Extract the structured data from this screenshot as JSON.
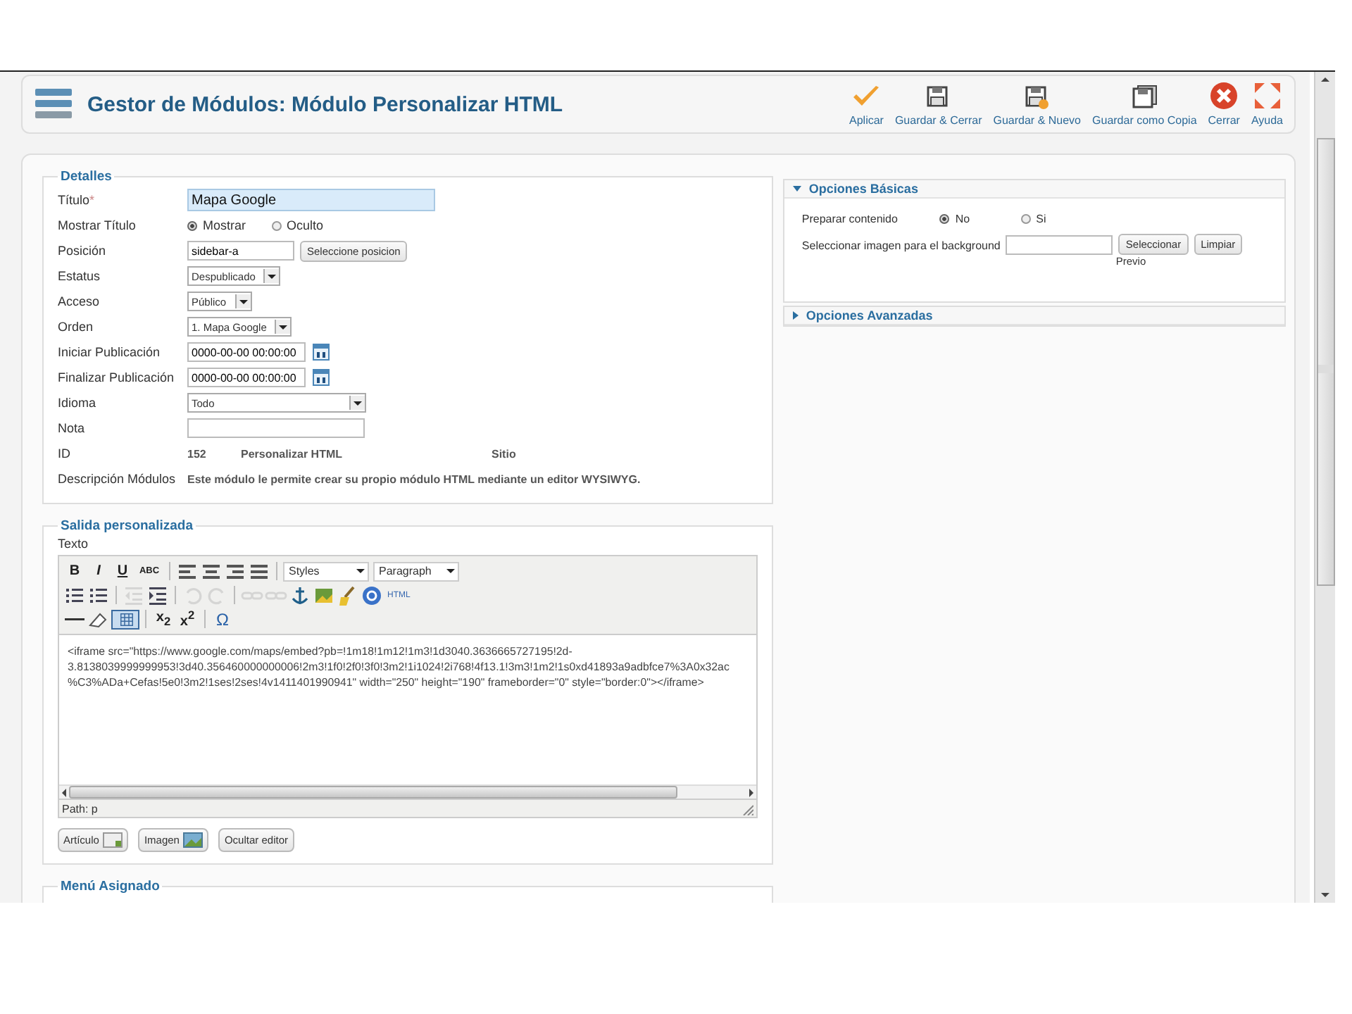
{
  "header": {
    "title": "Gestor de Módulos: Módulo Personalizar HTML",
    "actions": [
      {
        "kind": "apply",
        "label": "Aplicar"
      },
      {
        "kind": "save-close",
        "label": "Guardar & Cerrar"
      },
      {
        "kind": "save-new",
        "label": "Guardar & Nuevo"
      },
      {
        "kind": "save-copy",
        "label": "Guardar como Copia"
      },
      {
        "kind": "close",
        "label": "Cerrar"
      },
      {
        "kind": "help",
        "label": "Ayuda"
      }
    ]
  },
  "details": {
    "legend": "Detalles",
    "rows": [
      {
        "kind": "title",
        "label": "Título",
        "required": "*",
        "value": "Mapa Google"
      },
      {
        "kind": "radio",
        "label": "Mostrar Título",
        "options": [
          {
            "label": "Mostrar",
            "selected": true
          },
          {
            "label": "Oculto",
            "selected": false
          }
        ]
      },
      {
        "kind": "position",
        "label": "Posición",
        "value": "sidebar-a",
        "button": "Seleccione posicion"
      },
      {
        "kind": "select",
        "label": "Estatus",
        "value": "Despublicado"
      },
      {
        "kind": "select",
        "label": "Acceso",
        "value": "Público"
      },
      {
        "kind": "select",
        "label": "Orden",
        "value": "1. Mapa Google"
      },
      {
        "kind": "date",
        "label": "Iniciar Publicación",
        "value": "0000-00-00 00:00:00"
      },
      {
        "kind": "date",
        "label": "Finalizar Publicación",
        "value": "0000-00-00 00:00:00"
      },
      {
        "kind": "wide-select",
        "label": "Idioma",
        "value": "Todo"
      },
      {
        "kind": "text",
        "label": "Nota"
      },
      {
        "kind": "info",
        "label": "ID",
        "values": [
          "152",
          "Personalizar HTML",
          "Sitio"
        ]
      },
      {
        "kind": "desc",
        "label": "Descripción Módulos",
        "value": "Este módulo le permite crear su propio módulo HTML mediante un editor WYSIWYG."
      }
    ]
  },
  "output": {
    "legend": "Salida personalizada",
    "field_label": "Texto",
    "toolbar": [
      [
        {
          "kind": "bold",
          "label": "B"
        },
        {
          "kind": "italic",
          "label": "I"
        },
        {
          "kind": "underline",
          "label": "U"
        },
        {
          "kind": "strike",
          "label": "ABC"
        },
        {
          "kind": "sep"
        },
        {
          "kind": "align-left"
        },
        {
          "kind": "align-center"
        },
        {
          "kind": "align-right"
        },
        {
          "kind": "align-justify"
        },
        {
          "kind": "sep"
        },
        {
          "kind": "dropdown",
          "label": "Styles"
        },
        {
          "kind": "dropdown",
          "label": "Paragraph"
        }
      ],
      [
        {
          "kind": "bullets"
        },
        {
          "kind": "numbers"
        },
        {
          "kind": "sep"
        },
        {
          "kind": "outdent",
          "disabled": true
        },
        {
          "kind": "indent",
          "disabled": false
        },
        {
          "kind": "sep"
        },
        {
          "kind": "undo",
          "disabled": true
        },
        {
          "kind": "redo",
          "disabled": true
        },
        {
          "kind": "sep"
        },
        {
          "kind": "link",
          "disabled": true
        },
        {
          "kind": "unlink",
          "disabled": true
        },
        {
          "kind": "anchor"
        },
        {
          "kind": "image"
        },
        {
          "kind": "cleanup"
        },
        {
          "kind": "help"
        },
        {
          "kind": "html",
          "label": "HTML"
        }
      ],
      [
        {
          "kind": "rule"
        },
        {
          "kind": "eraser"
        },
        {
          "kind": "table",
          "selected": true
        },
        {
          "kind": "sep"
        },
        {
          "kind": "sub",
          "label": "x$_{2}$"
        },
        {
          "kind": "sup",
          "label": "x$^{2}$"
        },
        {
          "kind": "sep"
        },
        {
          "kind": "omega",
          "label": "Ω"
        }
      ]
    ],
    "content": [
      "<iframe src=\"https://www.google.com/maps/embed?pb=!1m18!1m12!1m3!1d3040.3636665727195!2d-",
      "3.8138039999999953!3d40.356460000000006!2m3!1f0!2f0!3f0!3m2!1i1024!2i768!4f13.1!3m3!1m2!1s0xd41893a9adbfce7%3A0x32ac",
      "%C3%ADa+Cefas!5e0!3m2!1ses!2ses!4v1411401990941\" width=\"250\" height=\"190\" frameborder=\"0\" style=\"border:0\"></iframe>"
    ],
    "path": "Path: p",
    "buttons": [
      {
        "kind": "article",
        "label": "Artículo"
      },
      {
        "kind": "image",
        "label": "Imagen"
      },
      {
        "kind": "plain",
        "label": "Ocultar editor"
      }
    ]
  },
  "menu": {
    "legend": "Menú Asignado"
  },
  "options": [
    {
      "title": "Opciones Básicas",
      "expanded": true,
      "prepare_label": "Preparar contenido",
      "radios": [
        {
          "label": "No",
          "selected": true
        },
        {
          "label": "Si",
          "selected": false
        }
      ],
      "image_label": "Seleccionar imagen para el background",
      "select_button": "Seleccionar",
      "clear_button": "Limpiar",
      "preview": "Previo"
    },
    {
      "title": "Opciones Avanzadas",
      "expanded": false
    }
  ]
}
